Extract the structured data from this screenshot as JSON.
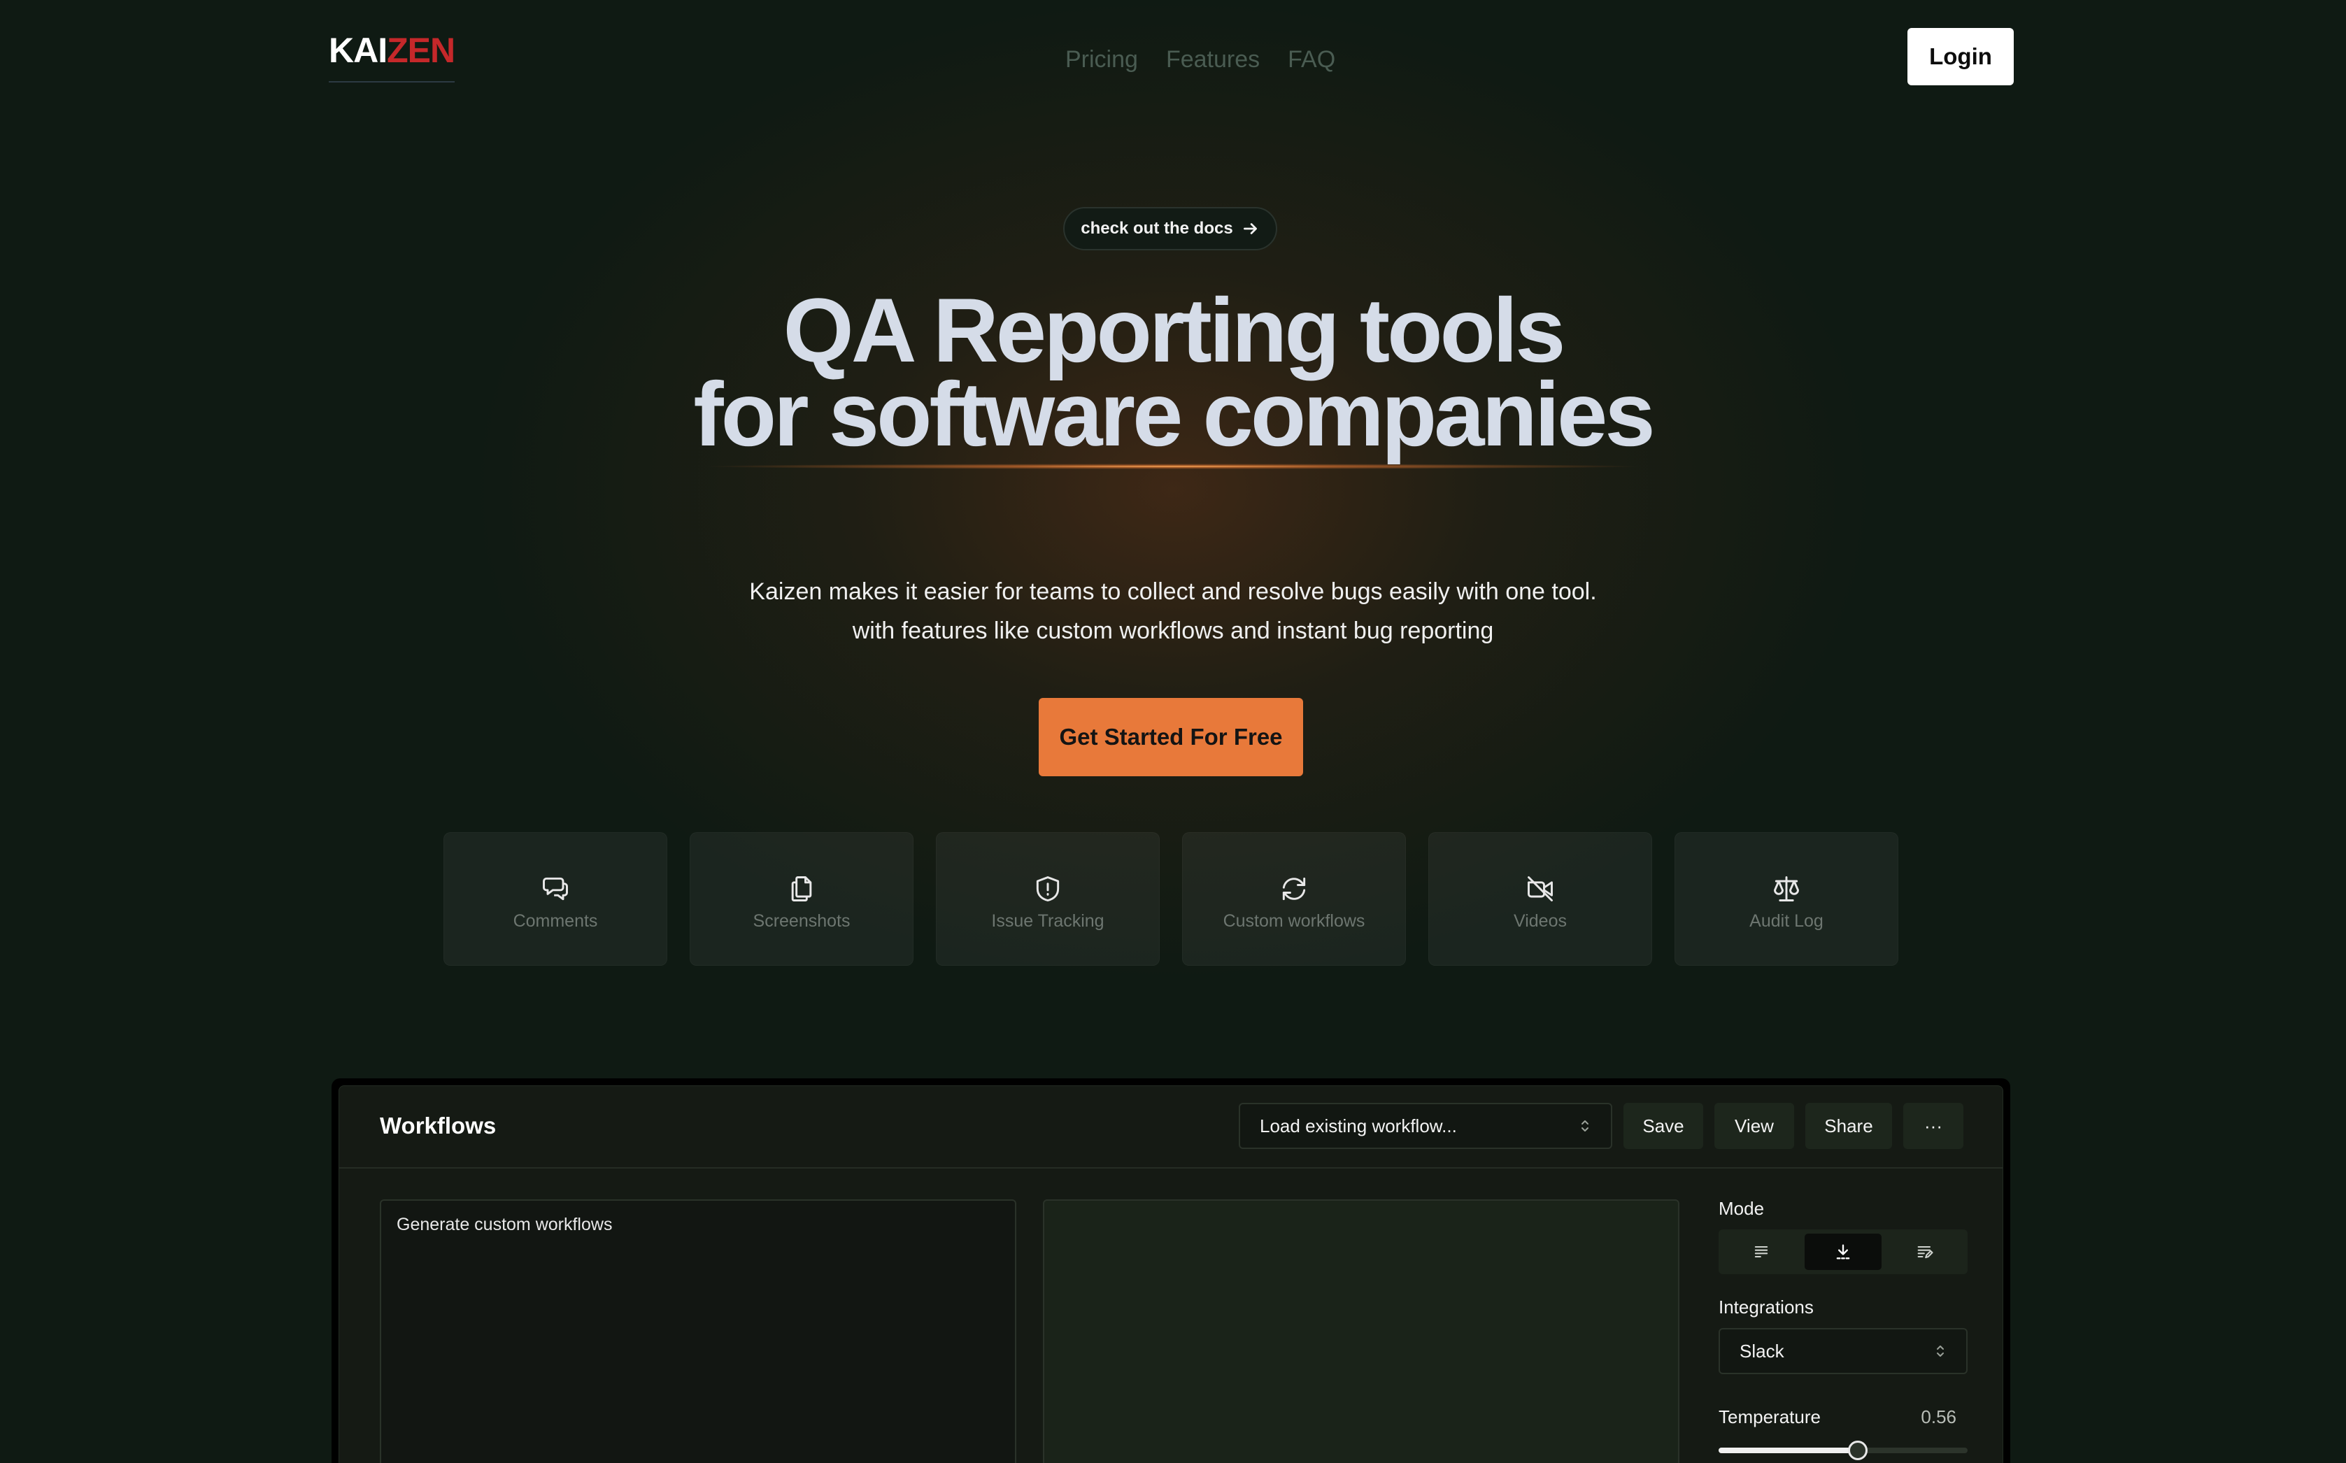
{
  "header": {
    "logo_part1": "KAI",
    "logo_part2": "ZEN",
    "nav": [
      "Pricing",
      "Features",
      "FAQ"
    ],
    "login_label": "Login"
  },
  "hero": {
    "docs_link": "check out the docs",
    "title_line1": "QA Reporting tools",
    "title_line2": "for software companies",
    "subtitle_line1": "Kaizen makes it easier for teams to collect and resolve bugs easily with one tool.",
    "subtitle_line2": "with features like custom workflows and instant bug reporting",
    "cta_label": "Get Started For Free"
  },
  "features": [
    {
      "label": "Comments",
      "icon": "comments-icon"
    },
    {
      "label": "Screenshots",
      "icon": "screenshots-icon"
    },
    {
      "label": "Issue Tracking",
      "icon": "shield-alert-icon"
    },
    {
      "label": "Custom workflows",
      "icon": "refresh-icon"
    },
    {
      "label": "Videos",
      "icon": "video-off-icon"
    },
    {
      "label": "Audit Log",
      "icon": "scale-icon"
    }
  ],
  "workflow_panel": {
    "title": "Workflows",
    "load_placeholder": "Load existing workflow...",
    "save_label": "Save",
    "view_label": "View",
    "share_label": "Share",
    "more_label": "···",
    "prompt_text": "Generate custom workflows",
    "mode_label": "Mode",
    "mode_options": [
      "complete",
      "insert",
      "edit"
    ],
    "mode_selected": "insert",
    "integrations_label": "Integrations",
    "integration_value": "Slack",
    "temperature_label": "Temperature",
    "temperature_value": "0.56",
    "temperature_fraction": 0.56
  },
  "colors": {
    "background": "#0f1a13",
    "accent": "#e8793a",
    "logo_red": "#c5282a",
    "title": "#d5dce8"
  }
}
